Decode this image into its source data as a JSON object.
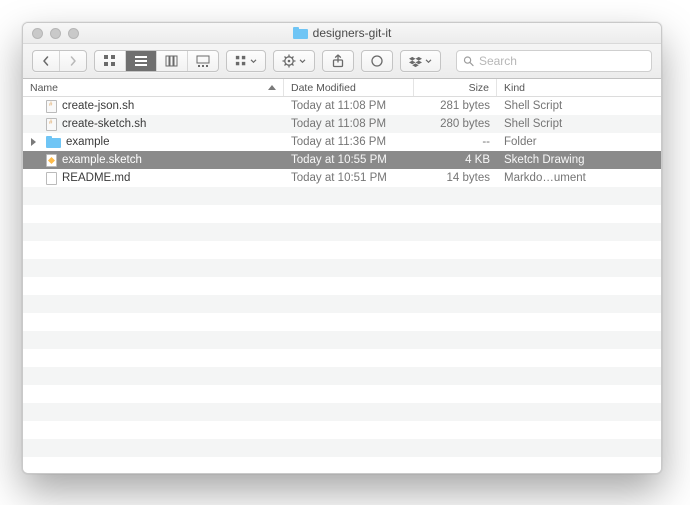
{
  "window": {
    "title": "designers-git-it"
  },
  "toolbar": {
    "search_placeholder": "Search"
  },
  "columns": {
    "name": "Name",
    "date": "Date Modified",
    "size": "Size",
    "kind": "Kind"
  },
  "rows": [
    {
      "name": "create-json.sh",
      "date": "Today at 11:08 PM",
      "size": "281 bytes",
      "kind": "Shell Script",
      "icon": "sh",
      "expandable": false,
      "selected": false
    },
    {
      "name": "create-sketch.sh",
      "date": "Today at 11:08 PM",
      "size": "280 bytes",
      "kind": "Shell Script",
      "icon": "sh",
      "expandable": false,
      "selected": false
    },
    {
      "name": "example",
      "date": "Today at 11:36 PM",
      "size": "--",
      "kind": "Folder",
      "icon": "folder",
      "expandable": true,
      "selected": false
    },
    {
      "name": "example.sketch",
      "date": "Today at 10:55 PM",
      "size": "4 KB",
      "kind": "Sketch Drawing",
      "icon": "sketch",
      "expandable": false,
      "selected": true
    },
    {
      "name": "README.md",
      "date": "Today at 10:51 PM",
      "size": "14 bytes",
      "kind": "Markdo…ument",
      "icon": "file",
      "expandable": false,
      "selected": false
    }
  ],
  "filler_rows": 16
}
